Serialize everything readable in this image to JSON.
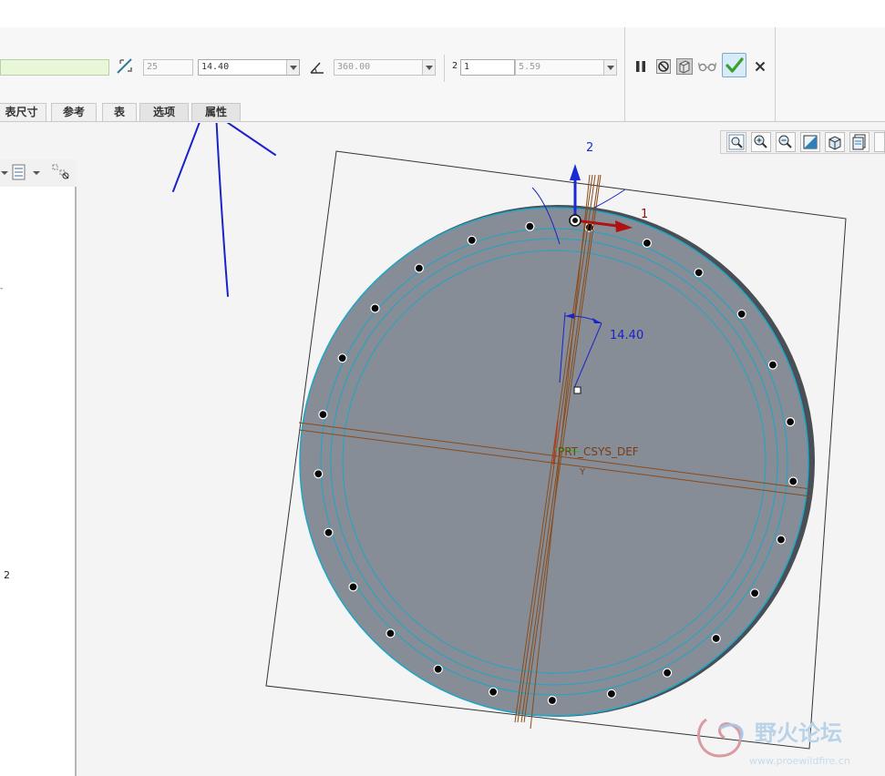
{
  "dashboard": {
    "distance_value": "",
    "count_value": "25",
    "angle_value": "14.40",
    "total_angle_value": "360.00",
    "second_count_label": "2",
    "second_count_value": "1",
    "second_dimension_value": "5.59"
  },
  "tabs": [
    {
      "label": "表尺寸"
    },
    {
      "label": "参考"
    },
    {
      "label": "表"
    },
    {
      "label": "选项"
    },
    {
      "label": "属性"
    }
  ],
  "controls": {
    "pause_icon": "pause-icon",
    "no_preview_icon": "circle-slash-icon",
    "feature_preview_icon": "preview-box-icon",
    "verify_icon": "glasses-icon",
    "accept_icon": "checkmark-icon",
    "cancel_icon": "close-icon"
  },
  "view_toolbar": [
    "zoom-fit-icon",
    "zoom-in-icon",
    "zoom-out-icon",
    "repaint-icon",
    "view-orientation-icon",
    "saved-views-icon",
    "display-style-icon"
  ],
  "left_panel": {
    "side_label": "2"
  },
  "graphics": {
    "axis_2_label": "2",
    "axis_1_label": "1",
    "angle_dim_label": "14.40",
    "csys_label": "PRT_CSYS_DEF",
    "csys_y_label": "Y",
    "hole_count": 25
  },
  "watermark": {
    "title": "野火论坛",
    "url": "www.proewildfire.cn"
  },
  "colors": {
    "part_fill": "#868d96",
    "part_edge": "#1ca6c7",
    "axis_blue": "#1a2bd4",
    "axis_red": "#b01212",
    "datum_plane": "#8a4b1a",
    "accept_green": "#7fcf3a",
    "annotation_ink": "#1a23c9"
  }
}
